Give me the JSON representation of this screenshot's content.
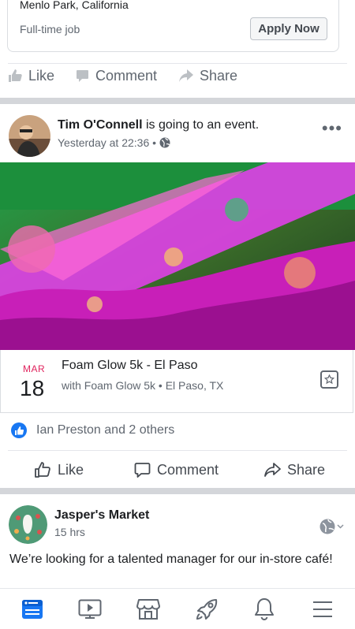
{
  "job_post": {
    "location": "Menlo Park, California",
    "job_type": "Full-time job",
    "apply_label": "Apply Now",
    "actions": {
      "like": "Like",
      "comment": "Comment",
      "share": "Share"
    }
  },
  "event_post": {
    "author": "Tim O'Connell",
    "activity": " is going to an event.",
    "timestamp": "Yesterday at 22:36 •",
    "privacy_icon": "globe-icon",
    "event": {
      "month": "MAR",
      "day": "18",
      "title": "Foam Glow 5k - El Paso",
      "subtitle": "with Foam Glow 5k • El Paso, TX"
    },
    "reactions_text": "Ian Preston and 2 others",
    "actions": {
      "like": "Like",
      "comment": "Comment",
      "share": "Share"
    }
  },
  "page_post": {
    "author": "Jasper's Market",
    "timestamp": "15 hrs",
    "text": "We’re looking for a talented manager for our in-store café!"
  },
  "bottom_nav": {
    "items": [
      "news-feed-icon",
      "watch-icon",
      "marketplace-icon",
      "rocket-icon",
      "notifications-icon",
      "menu-icon"
    ],
    "active": "news-feed-icon",
    "accent": "#1877f2"
  }
}
